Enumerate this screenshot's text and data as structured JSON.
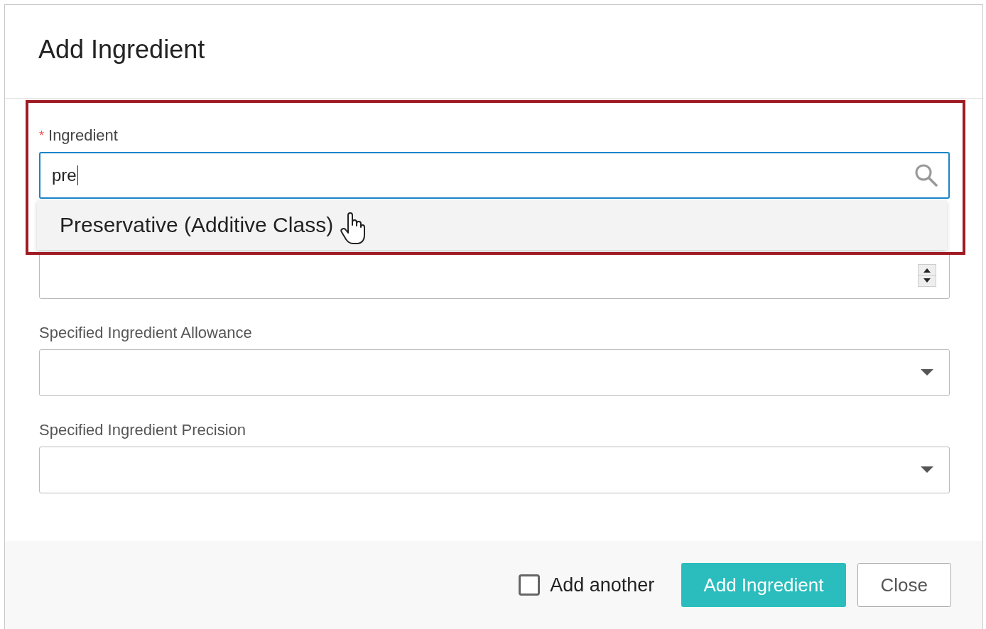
{
  "dialog": {
    "title": "Add Ingredient"
  },
  "fields": [
    {
      "kind": "search",
      "label": "Ingredient",
      "required": true,
      "required_mark": "*",
      "value": "pre",
      "focused": true
    },
    {
      "kind": "number"
    },
    {
      "kind": "select",
      "label": "Specified Ingredient Allowance",
      "required": false,
      "focused": false
    },
    {
      "kind": "select",
      "label": "Specified Ingredient Precision",
      "required": false,
      "focused": false
    }
  ],
  "suggestions": [
    {
      "label": "Preservative (Additive Class)",
      "hovered": true
    }
  ],
  "add_another": {
    "label": "Add another",
    "checked": false
  },
  "buttons": [
    {
      "label": "Add Ingredient",
      "kind": "primary"
    },
    {
      "label": "Close",
      "kind": "secondary"
    }
  ]
}
